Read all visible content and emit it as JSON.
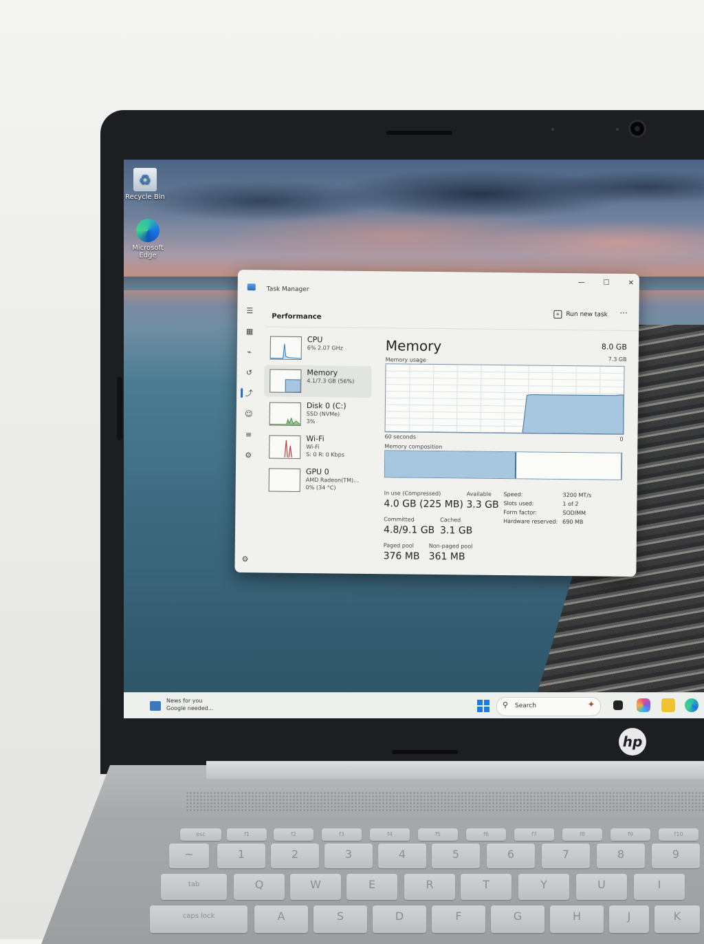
{
  "desktop": {
    "icons": [
      {
        "label": "Recycle Bin"
      },
      {
        "label": "Microsoft\nEdge"
      }
    ]
  },
  "task_manager": {
    "window_title": "Task Manager",
    "page_title": "Performance",
    "run_new_task": "Run new task",
    "more": "···",
    "resources": [
      {
        "name": "CPU",
        "line1": "6%  2.07 GHz",
        "line2": ""
      },
      {
        "name": "Memory",
        "line1": "4.1/7.3 GB (56%)",
        "line2": ""
      },
      {
        "name": "Disk 0 (C:)",
        "line1": "SSD (NVMe)",
        "line2": "3%"
      },
      {
        "name": "Wi-Fi",
        "line1": "Wi-Fi",
        "line2": "S: 0  R: 0 Kbps"
      },
      {
        "name": "GPU 0",
        "line1": "AMD Radeon(TM)...",
        "line2": "0%  (34 °C)"
      }
    ],
    "detail": {
      "title": "Memory",
      "total": "8.0 GB",
      "usage_label": "Memory usage",
      "usage_max": "7.3 GB",
      "time_label": "60 seconds",
      "time_end": "0",
      "composition_label": "Memory composition",
      "usage_history_fraction": [
        0.0,
        0.0,
        0.0,
        0.0,
        0.0,
        0.0,
        0.0,
        0.0,
        0.0,
        0.0,
        0.0,
        0.0,
        0.0,
        0.0,
        0.0,
        0.0,
        0.0,
        0.0,
        0.0,
        0.0,
        0.0,
        0.0,
        0.0,
        0.0,
        0.0,
        0.0,
        0.0,
        0.0,
        0.0,
        0.0,
        0.0,
        0.0,
        0.0,
        0.0,
        0.0,
        0.56,
        0.57,
        0.57,
        0.57,
        0.57,
        0.57,
        0.57,
        0.57,
        0.57,
        0.57,
        0.57,
        0.57,
        0.57,
        0.57,
        0.57,
        0.57,
        0.57,
        0.57,
        0.57,
        0.57,
        0.57,
        0.57,
        0.57,
        0.58,
        0.58
      ],
      "composition_inuse_fraction": 0.55,
      "composition_standby_fraction": 0.44,
      "stats": {
        "in_use_label": "In use (Compressed)",
        "in_use_value": "4.0 GB (225 MB)",
        "available_label": "Available",
        "available_value": "3.3 GB",
        "committed_label": "Committed",
        "committed_value": "4.8/9.1 GB",
        "cached_label": "Cached",
        "cached_value": "3.1 GB",
        "paged_label": "Paged pool",
        "paged_value": "376 MB",
        "nonpaged_label": "Non-paged pool",
        "nonpaged_value": "361 MB"
      },
      "specs": [
        {
          "label": "Speed:",
          "value": "3200 MT/s"
        },
        {
          "label": "Slots used:",
          "value": "1 of 2"
        },
        {
          "label": "Form factor:",
          "value": "SODIMM"
        },
        {
          "label": "Hardware reserved:",
          "value": "690 MB"
        }
      ]
    }
  },
  "taskbar": {
    "news_title": "News for you",
    "news_sub": "Google needed...",
    "search_placeholder": "Search"
  },
  "laptop": {
    "brand": "hp"
  },
  "keyboard": {
    "function_row": [
      "esc",
      "f1",
      "f2",
      "f3",
      "f4",
      "f5",
      "f6",
      "f7",
      "f8",
      "f9",
      "f10"
    ],
    "number_row": [
      "~",
      "1",
      "2",
      "3",
      "4",
      "5",
      "6",
      "7",
      "8",
      "9"
    ],
    "top_row": [
      "tab",
      "Q",
      "W",
      "E",
      "R",
      "T",
      "Y",
      "U",
      "I"
    ],
    "home_row": [
      "caps lock",
      "A",
      "S",
      "D",
      "F",
      "G",
      "H",
      "J",
      "K"
    ]
  },
  "colors": {
    "accent": "#1a6ad6",
    "memory_fill": "#a7c6df",
    "memory_line": "#3e6f9a"
  }
}
